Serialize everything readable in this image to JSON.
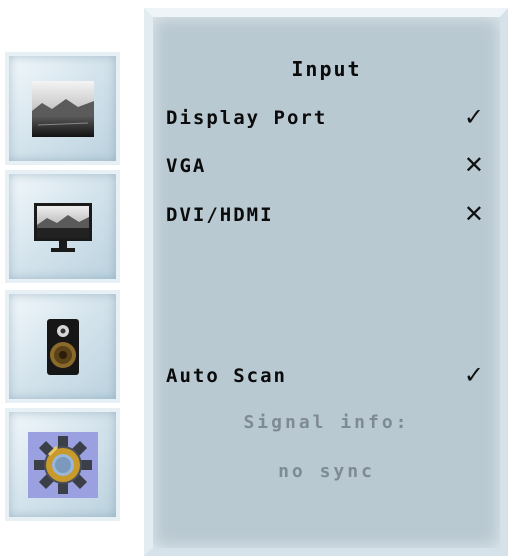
{
  "sidebar": {
    "items": [
      {
        "id": "picture",
        "icon": "landscape-picture-icon"
      },
      {
        "id": "display",
        "icon": "monitor-icon"
      },
      {
        "id": "audio",
        "icon": "speaker-icon"
      },
      {
        "id": "setup",
        "icon": "gear-icon",
        "selected": true
      }
    ]
  },
  "panel": {
    "title": "Input",
    "options": [
      {
        "label": "Display Port",
        "mark": "✓",
        "state": "checked"
      },
      {
        "label": "VGA",
        "mark": "✕",
        "state": "unavailable"
      },
      {
        "label": "DVI/HDMI",
        "mark": "✕",
        "state": "unavailable"
      }
    ],
    "auto_scan": {
      "label": "Auto Scan",
      "mark": "✓",
      "state": "checked"
    },
    "signal_info_label": "Signal info:",
    "signal_value": "no sync"
  },
  "colors": {
    "panel_bg": "#b9c9d2",
    "text": "#0b0b0b",
    "muted_text": "#7f8b92",
    "selected_tile": "#9aa0e0"
  }
}
